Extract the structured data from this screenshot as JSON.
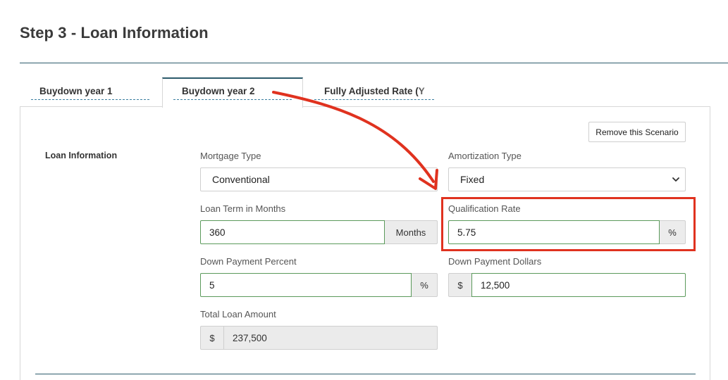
{
  "page": {
    "title": "Step 3 - Loan Information"
  },
  "tabs": [
    {
      "label": "Buydown year 1",
      "active": false
    },
    {
      "label": "Buydown year 2",
      "active": true
    },
    {
      "label": "Fully Adjusted Rate (Y",
      "active": false
    }
  ],
  "scenario": {
    "remove_label": "Remove this Scenario"
  },
  "section": {
    "label": "Loan Information"
  },
  "fields": {
    "mortgage_type": {
      "label": "Mortgage Type",
      "value": "Conventional"
    },
    "amortization_type": {
      "label": "Amortization Type",
      "value": "Fixed"
    },
    "loan_term": {
      "label": "Loan Term in Months",
      "value": "360",
      "suffix": "Months"
    },
    "qualification_rate": {
      "label": "Qualification Rate",
      "value": "5.75",
      "suffix": "%"
    },
    "down_payment_percent": {
      "label": "Down Payment Percent",
      "value": "5",
      "suffix": "%"
    },
    "down_payment_dollars": {
      "label": "Down Payment Dollars",
      "value": "12,500",
      "prefix": "$"
    },
    "total_loan_amount": {
      "label": "Total Loan Amount",
      "value": "237,500",
      "prefix": "$"
    }
  },
  "colors": {
    "accent": "#2c5a6b",
    "annotation": "#e0321f",
    "valid_border": "#5b9a5b"
  },
  "icons": {
    "select": "chevron-down-icon",
    "annotation": "arrow-annotation"
  }
}
